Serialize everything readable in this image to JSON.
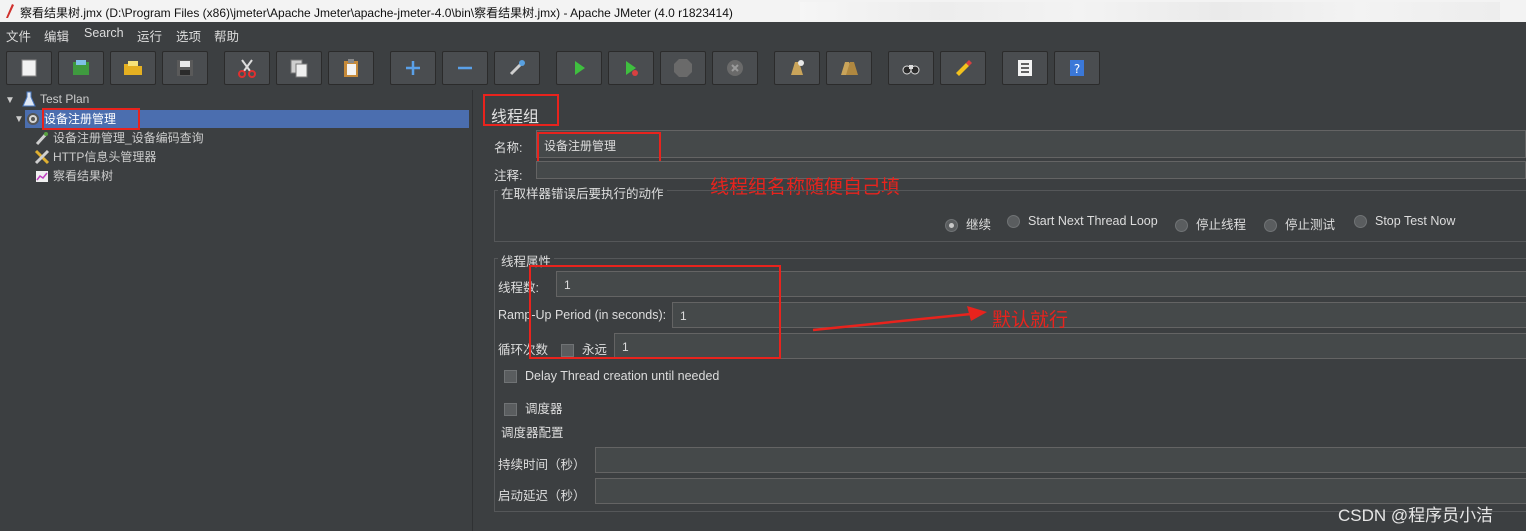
{
  "window": {
    "title": "察看结果树.jmx (D:\\Program Files (x86)\\jmeter\\Apache Jmeter\\apache-jmeter-4.0\\bin\\察看结果树.jmx) - Apache JMeter (4.0 r1823414)"
  },
  "menu": [
    "文件",
    "编辑",
    "Search",
    "运行",
    "选项",
    "帮助"
  ],
  "toolbar_icons": [
    "new-icon",
    "templates-icon",
    "open-icon",
    "save-icon",
    "cut-icon",
    "copy-icon",
    "paste-icon",
    "expand-icon",
    "collapse-icon",
    "toggle-icon",
    "start-icon",
    "start-no-pause-icon",
    "stop-icon",
    "shutdown-icon",
    "clear-icon",
    "clear-all-icon",
    "search-icon",
    "reset-search-icon",
    "function-helper-icon",
    "help-icon"
  ],
  "tree": {
    "items": [
      {
        "label": "Test Plan",
        "icon": "test-plan-icon"
      },
      {
        "label": "设备注册管理",
        "icon": "thread-group-icon"
      },
      {
        "label": "设备注册管理_设备编码查询",
        "icon": "http-sampler-icon"
      },
      {
        "label": "HTTP信息头管理器",
        "icon": "header-manager-icon"
      },
      {
        "label": "察看结果树",
        "icon": "results-tree-icon"
      }
    ]
  },
  "panel": {
    "title": "线程组",
    "name_label": "名称:",
    "name_value": "设备注册管理",
    "comment_label": "注释:",
    "on_error": {
      "legend": "在取样器错误后要执行的动作",
      "options": [
        "继续",
        "Start Next Thread Loop",
        "停止线程",
        "停止测试",
        "Stop Test Now"
      ],
      "selected": "继续"
    },
    "thread_props": {
      "legend": "线程属性",
      "threads_label": "线程数:",
      "threads_value": "1",
      "rampup_label": "Ramp-Up Period (in seconds):",
      "rampup_value": "1",
      "loop_label": "循环次数",
      "forever_label": "永远",
      "forever_checked": false,
      "loop_value": "1",
      "delay_label": "Delay Thread creation until needed",
      "delay_checked": false,
      "scheduler_label": "调度器",
      "scheduler_checked": false
    },
    "scheduler_config": {
      "legend": "调度器配置",
      "duration_label": "持续时间（秒）",
      "duration_value": "",
      "delay_label": "启动延迟（秒）",
      "delay_value": ""
    }
  },
  "annotations": {
    "name_hint": "线程组名称随便自己填",
    "default_hint": "默认就行",
    "color": "#e8231d"
  },
  "watermark": "CSDN @程序员小洁",
  "colors": {
    "background": "#3c3f41",
    "selection": "#4b6eaf",
    "field": "#45494a",
    "annotation_red": "#e8231d"
  }
}
